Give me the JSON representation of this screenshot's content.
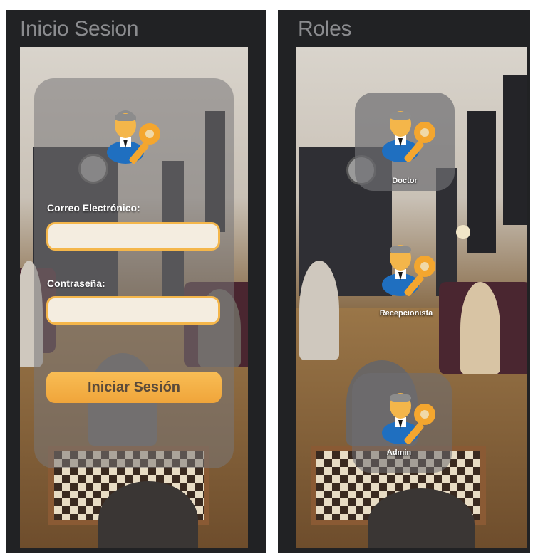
{
  "login_screen": {
    "title": "Inicio Sesion",
    "email_label": "Correo Electrónico:",
    "email_value": "",
    "password_label": "Contraseña:",
    "password_value": "",
    "submit_label": "Iniciar Sesión"
  },
  "roles_screen": {
    "title": "Roles",
    "roles": [
      {
        "label": "Doctor"
      },
      {
        "label": "Recepcionista"
      },
      {
        "label": "Admin"
      }
    ]
  },
  "colors": {
    "panel_bg": "#212224",
    "accent": "#f4b64a",
    "input_bg": "#f4ede0",
    "title_gray": "#8a8b8e"
  },
  "icons": {
    "user_key": "user-key-icon"
  }
}
